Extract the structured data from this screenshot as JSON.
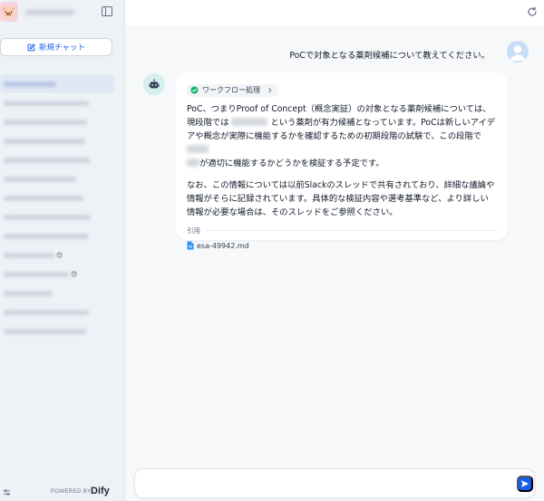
{
  "sidebar": {
    "app_logo_icon": "pig-face-icon",
    "new_chat_label": "新規チャット",
    "conversation_count": 14,
    "powered_by": "POWERED BY",
    "brand": "Dify"
  },
  "header": {
    "refresh_icon": "refresh-icon"
  },
  "chat": {
    "user_message": "PoCで対象となる薬剤候補について教えてください。",
    "workflow_label": "ワークフロー処理",
    "answer_p1_a": "PoC、つまりProof of Concept（概念実証）の対象となる薬剤候補については、現段階では",
    "answer_p1_b": "という薬剤が有力候補となっています。PoCは新しいアイデアや概念が実際に機能するかを確認するための初期段階の試験で、この段階で",
    "answer_p1_c": "が適切に機能するかどうかを検証する予定です。",
    "answer_p2": "なお、この情報については以前Slackのスレッドで共有されており、詳細な議論や情報がそらに記録されています。具体的な検証内容や選考基準など、より詳しい情報が必要な場合は、そのスレッドをご参照ください。",
    "citation_label": "引用",
    "citation_file": "esa-49942.md"
  },
  "composer": {
    "placeholder": "",
    "value": ""
  },
  "colors": {
    "accent": "#155eef",
    "sidebar_bg": "#eef1f6",
    "main_bg": "#f7f8fa",
    "success": "#12b76a"
  }
}
